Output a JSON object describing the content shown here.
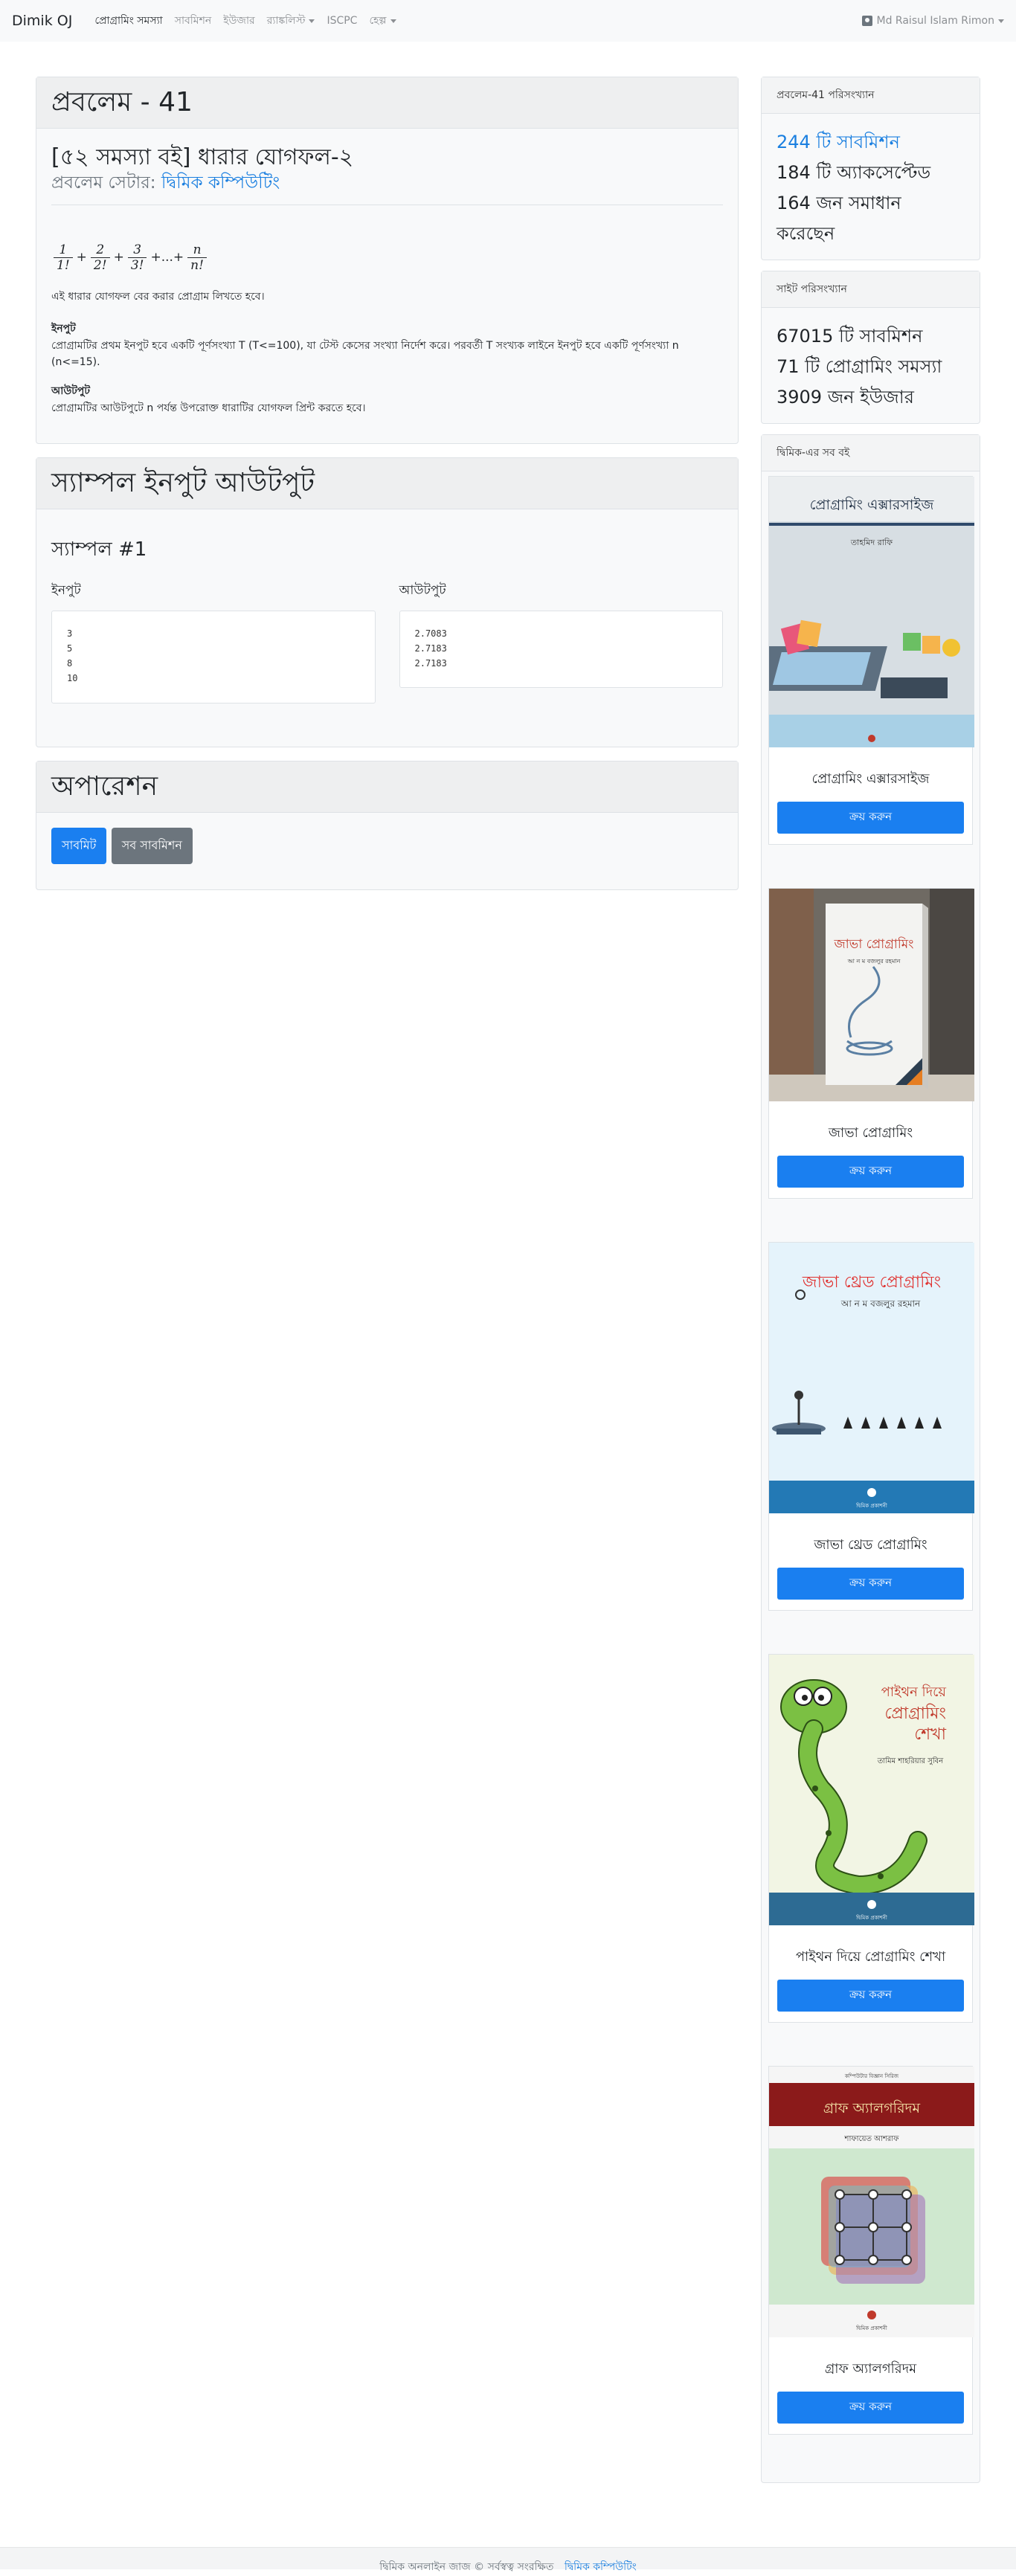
{
  "navbar": {
    "brand": "Dimik OJ",
    "items": [
      {
        "label": "প্রোগ্রামিং সমস্যা",
        "active": true
      },
      {
        "label": "সাবমিশন"
      },
      {
        "label": "ইউজার"
      },
      {
        "label": "র‍্যাঙ্কলিস্ট"
      },
      {
        "label": "ISCPC"
      },
      {
        "label": "হেল্প"
      }
    ],
    "user": "Md Raisul Islam Rimon"
  },
  "problem": {
    "heading": "প্রবলেম - 41",
    "title": "[৫২ সমস্যা বই] ধারার যোগফল-২",
    "setter_label": "প্রবলেম সেটার:",
    "setter_name": "দ্বিমিক কম্পিউটিং",
    "formula": {
      "terms": [
        {
          "num": "1",
          "den": "1!"
        },
        {
          "num": "2",
          "den": "2!"
        },
        {
          "num": "3",
          "den": "3!"
        },
        {
          "num": "n",
          "den": "n!"
        }
      ],
      "plus": "+",
      "ellipsis": "+...+"
    },
    "description": "এই ধারার যোগফল বের করার প্রোগ্রাম লিখতে হবে।",
    "input_label": "ইনপুট",
    "input_text": "প্রোগ্রামটির প্রথম ইনপুট হবে একটি পূর্ণসংখ্যা T (T<=100), যা টেস্ট কেসের সংখ্যা নির্দেশ করে। পরবর্তী T সংখ্যক লাইনে ইনপুট হবে একটি পূর্ণসংখ্যা n (n<=15).",
    "output_label": "আউটপুট",
    "output_text": "প্রোগ্রামটির আউটপুটে n পর্যন্ত উপরোক্ত ধারাটির যোগফল প্রিন্ট করতে হবে।"
  },
  "samples": {
    "heading": "স্যাম্পল ইনপুট আউটপুট",
    "sample_title": "স্যাম্পল #1",
    "input_label": "ইনপুট",
    "output_label": "আউটপুট",
    "input_lines": [
      "3",
      "5",
      "8",
      "10"
    ],
    "output_lines": [
      "2.7083",
      "2.7183",
      "2.7183"
    ]
  },
  "operations": {
    "heading": "অপারেশন",
    "submit_label": "সাবমিট",
    "all_submissions_label": "সব সাবমিশন"
  },
  "problem_stats": {
    "header": "প্রবলেম-41 পরিসংখ্যান",
    "submissions": "244 টি সাবমিশন",
    "accepted": "184 টি অ্যাকসেপ্টেড",
    "solved": "164 জন সমাধান করেছেন"
  },
  "site_stats": {
    "header": "সাইট পরিসংখ্যান",
    "submissions": "67015 টি সাবমিশন",
    "problems": "71 টি প্রোগ্রামিং সমস্যা",
    "users": "3909 জন ইউজার"
  },
  "books": {
    "header": "দ্বিমিক-এর সব বই",
    "buy_label": "ক্রয় করুন",
    "items": [
      {
        "title": "প্রোগ্রামিং এক্সারসাইজ",
        "cover_title": "প্রোগ্রামিং এক্সারসাইজ",
        "cover_author": "তাহমিদ রাফি"
      },
      {
        "title": "জাভা প্রোগ্রামিং",
        "cover_title": "জাভা প্রোগ্রামিং",
        "cover_author": "আ ন ম বজলুর রহমান"
      },
      {
        "title": "জাভা থ্রেড প্রোগ্রামিং",
        "cover_title": "জাভা থ্রেড প্রোগ্রামিং",
        "cover_author": "আ ন ম বজলুর রহমান"
      },
      {
        "title": "পাইথন দিয়ে প্রোগ্রামিং শেখা",
        "cover_title_1": "পাইথন দিয়ে",
        "cover_title_2": "প্রোগ্রামিং",
        "cover_title_3": "শেখা",
        "cover_author": "তামিম শাহরিয়ার সুবিন"
      },
      {
        "title": "গ্রাফ অ্যালগরিদম",
        "cover_series": "কম্পিউটার বিজ্ঞান সিরিজ",
        "cover_title": "গ্রাফ অ্যালগরিদম",
        "cover_author": "শাফায়েত আশরাফ"
      }
    ],
    "publisher": "দ্বিমিক প্রকাশনী"
  },
  "footer": {
    "text": "দ্বিমিক অনলাইন জাজ © সর্বস্বত্ব সংরক্ষিত",
    "link": "দ্বিমিক কম্পিউটিং"
  }
}
